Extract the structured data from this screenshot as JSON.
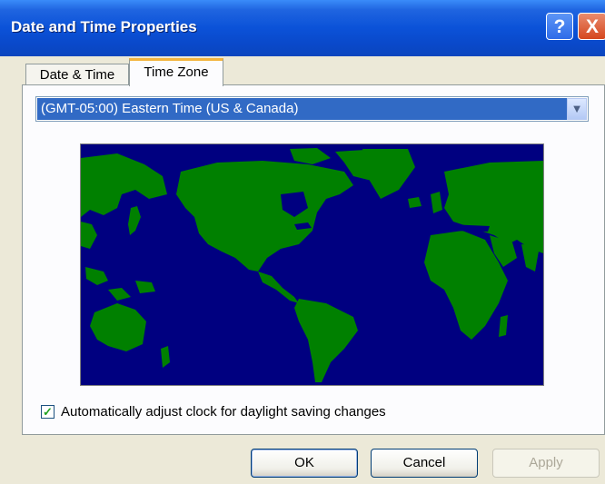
{
  "window": {
    "title": "Date and Time Properties",
    "help_label": "?",
    "close_label": "X"
  },
  "tabs": [
    {
      "label": "Date & Time",
      "active": false
    },
    {
      "label": "Time Zone",
      "active": true
    }
  ],
  "timezone": {
    "selected": "(GMT-05:00) Eastern Time (US & Canada)"
  },
  "map": {
    "ocean_color": "#000080",
    "land_color": "#008000"
  },
  "dst": {
    "label": "Automatically adjust clock for daylight saving changes",
    "checked": true
  },
  "buttons": {
    "ok": "OK",
    "cancel": "Cancel",
    "apply": "Apply"
  },
  "icons": {
    "checkmark": "✓",
    "dropdown": "▼"
  }
}
